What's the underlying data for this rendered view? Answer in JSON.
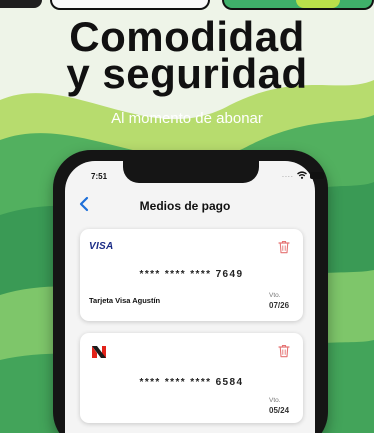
{
  "headline": {
    "line1": "Comodidad",
    "line2": "y seguridad"
  },
  "subtitle": "Al momento de abonar",
  "status_bar": {
    "time": "7:51"
  },
  "app": {
    "title": "Medios de pago"
  },
  "cards": [
    {
      "brand": "VISA",
      "brand_icon": "visa-logo",
      "number": "**** **** **** 7649",
      "holder": "Tarjeta Visa Agustín",
      "expiry_label": "Vto.",
      "expiry": "07/26"
    },
    {
      "brand_icon": "naranja-logo",
      "number": "**** **** **** 6584",
      "expiry_label": "Vto.",
      "expiry": "05/24"
    }
  ],
  "colors": {
    "headline": "#111111",
    "subtitle": "#ffffff",
    "accent_green": "#3fae5a",
    "visa_blue": "#1a2b86",
    "delete_red": "#e57373",
    "back_blue": "#1e6fd9"
  }
}
